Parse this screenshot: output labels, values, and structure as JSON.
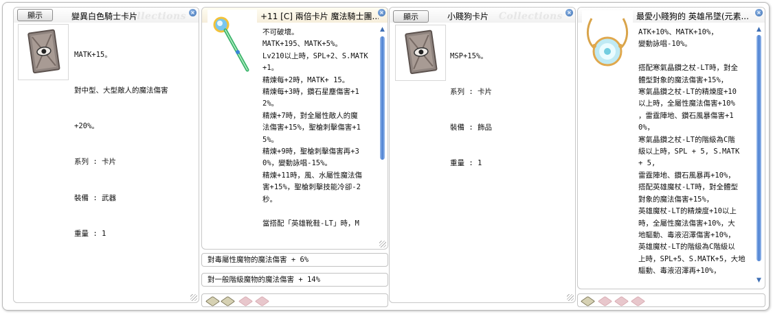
{
  "watermark": "Collections",
  "show_label": "顯示",
  "colors": {
    "accent": "#4a7fd1",
    "slot_filled": "#d6d1b3",
    "slot_empty": "#e8c7cc"
  },
  "window1": {
    "title": "變異白色騎士卡片",
    "lines": [
      "MATK+15。",
      "對中型、大型敵人的魔法傷害",
      "+20%。"
    ],
    "type_label": "系列",
    "type_value": "卡片",
    "equip_label": "裝備",
    "equip_value": "武器",
    "weight_label": "重量",
    "weight_value": "1",
    "image_icon": "card-icon"
  },
  "window2": {
    "title": "+11 [C] 兩倍卡片 魔法騎士團...",
    "text": "不可破壞。\nMATK+195、MATK+5%。\nLv210以上時，SPL+2、S.MATK\n+1。\n精煉每+2時，MATK+ 15。\n精煉每+3時，鑽石星塵傷害+1\n2%。\n精煉+7時，對全屬性敵人的魔\n法傷害+15%，聖槍刺擊傷害+1\n5%。\n精煉+9時，聖槍刺擊傷害再+3\n0%，變動詠唱-15%。\n精煉+11時，風、水屬性魔法傷\n害+15%，聖槍刺擊技能冷卻-2\n秒。\n\n當搭配「英雄靴鞋-LT」時，M",
    "bonus1": "對毒屬性魔物的魔法傷害 + 6%",
    "bonus2": "對一般階級魔物的魔法傷害 + 14%",
    "slots_filled": 2,
    "slots_total": 4,
    "image_icon": "staff-icon"
  },
  "window3": {
    "title": "小賤狗卡片",
    "lines": [
      "MSP+15%。"
    ],
    "type_label": "系列",
    "type_value": "卡片",
    "equip_label": "裝備",
    "equip_value": "飾品",
    "weight_label": "重量",
    "weight_value": "1",
    "image_icon": "card-icon"
  },
  "window4": {
    "title": "最愛小賤狗的 英雄吊墜(元素...",
    "text": "ATK+10%、MATK+10%，\n變動詠唱-10%。\n\n搭配寒氣晶鑽之杖-LT時，對全\n體型對象的魔法傷害+15%，\n寒氣晶鑽之杖-LT的精煉度+10\n以上時，全屬性魔法傷害+10%\n，雷霆陣地、鑽石風暴傷害+1\n0%，\n寒氣晶鑽之杖-LT的階級為C階\n級以上時，SPL + 5, S.MATK\n+ 5,\n雷霆陣地、鑽石風暴再+10%，\n搭配英雄魔杖-LT時，對全體型\n對象的魔法傷害+15%，\n英雄魔杖-LT的精煉度+10以上\n時，全屬性魔法傷害+10%，大\n地驅動、毒液沼澤傷害+10%，\n英雄魔杖-LT的階級為C階級以\n上時，SPL+5、S.MATK+5，大地\n驅動、毒液沼澤再+10%，",
    "slots_filled": 1,
    "slots_total": 4,
    "image_icon": "pendant-icon"
  }
}
